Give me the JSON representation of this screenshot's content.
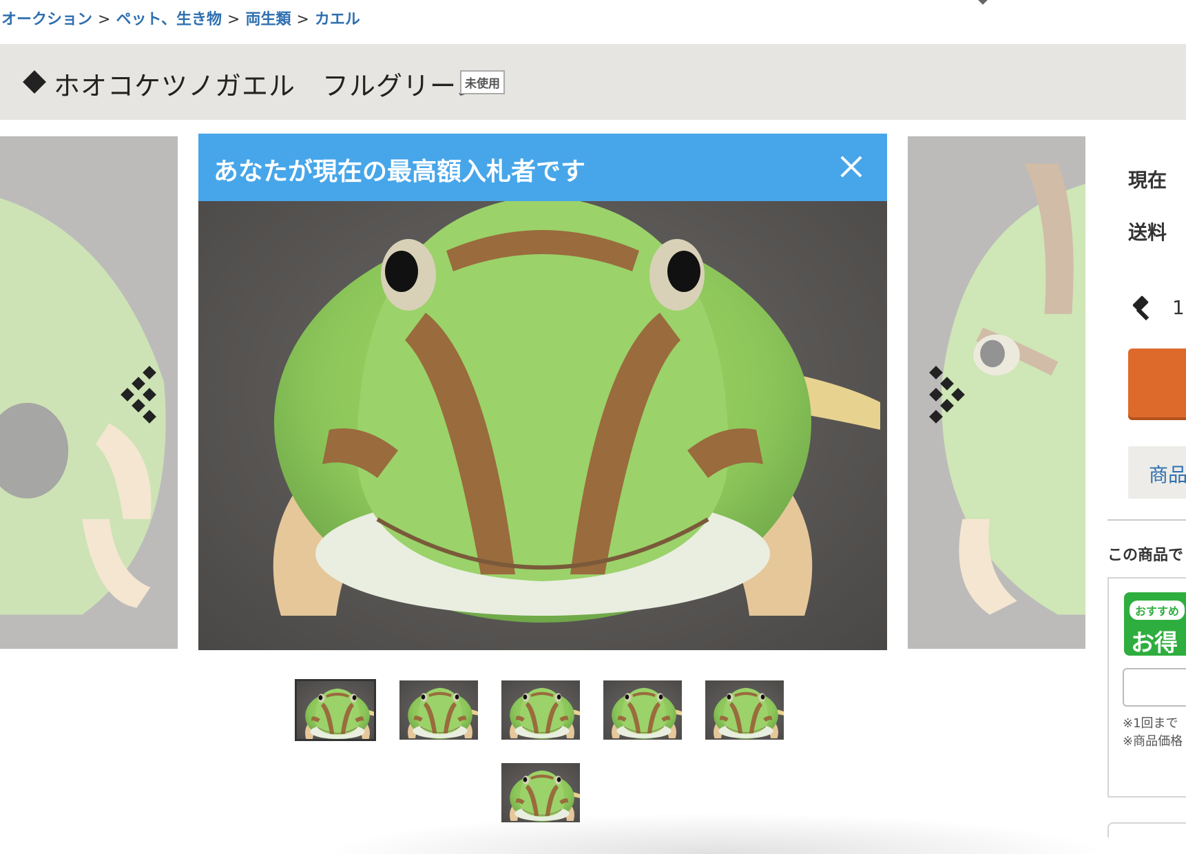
{
  "breadcrumb": {
    "items": [
      "オークション",
      "ペット、生き物",
      "両生類",
      "カエル"
    ],
    "separator": ">"
  },
  "item": {
    "title": "ホオコケツノガエル　フルグリーン",
    "condition_badge": "未使用"
  },
  "gallery": {
    "bidder_notice": "あなたが現在の最高額入札者です",
    "thumbnail_count": 6,
    "selected_thumbnail": 1
  },
  "side_panel": {
    "current_label": "現在",
    "shipping_label": "送料",
    "bid_count_partial": "1",
    "detail_button_partial": "商品",
    "section_heading_partial": "この商品で",
    "promo_pill_partial": "おすすめ",
    "promo_big_partial": "お得",
    "note1_partial": "※1回まで",
    "note2_partial": "※商品価格"
  },
  "colors": {
    "link": "#2e6fb0",
    "notice_bg": "#47a6e9",
    "bid_button": "#dd6a2b",
    "title_bar_bg": "#e6e5e1",
    "promo_green": "#2eae3e"
  },
  "icons": [
    "gavel-icon",
    "close-icon",
    "chevron-left-icon",
    "chevron-right-icon",
    "diamond-bullet-icon"
  ]
}
